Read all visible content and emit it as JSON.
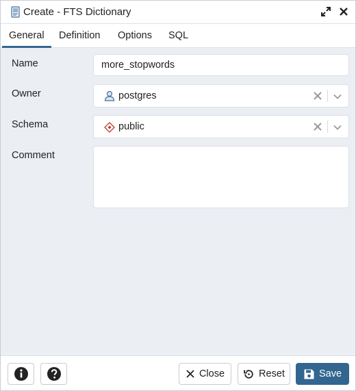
{
  "window": {
    "title": "Create - FTS Dictionary",
    "icons": {
      "title": "fts-dictionary-icon",
      "expand": "expand-icon",
      "close": "close-icon"
    }
  },
  "tabs": [
    {
      "label": "General",
      "active": true
    },
    {
      "label": "Definition",
      "active": false
    },
    {
      "label": "Options",
      "active": false
    },
    {
      "label": "SQL",
      "active": false
    }
  ],
  "form": {
    "name": {
      "label": "Name",
      "value": "more_stopwords"
    },
    "owner": {
      "label": "Owner",
      "value": "postgres",
      "icon": "user-icon"
    },
    "schema": {
      "label": "Schema",
      "value": "public",
      "icon": "schema-icon"
    },
    "comment": {
      "label": "Comment",
      "value": ""
    }
  },
  "footer": {
    "info_icon": "info-icon",
    "help_icon": "help-icon",
    "close_label": "Close",
    "reset_label": "Reset",
    "save_label": "Save"
  },
  "colors": {
    "accent": "#326690",
    "background": "#ebeef3",
    "schema_icon": "#c0392b"
  }
}
